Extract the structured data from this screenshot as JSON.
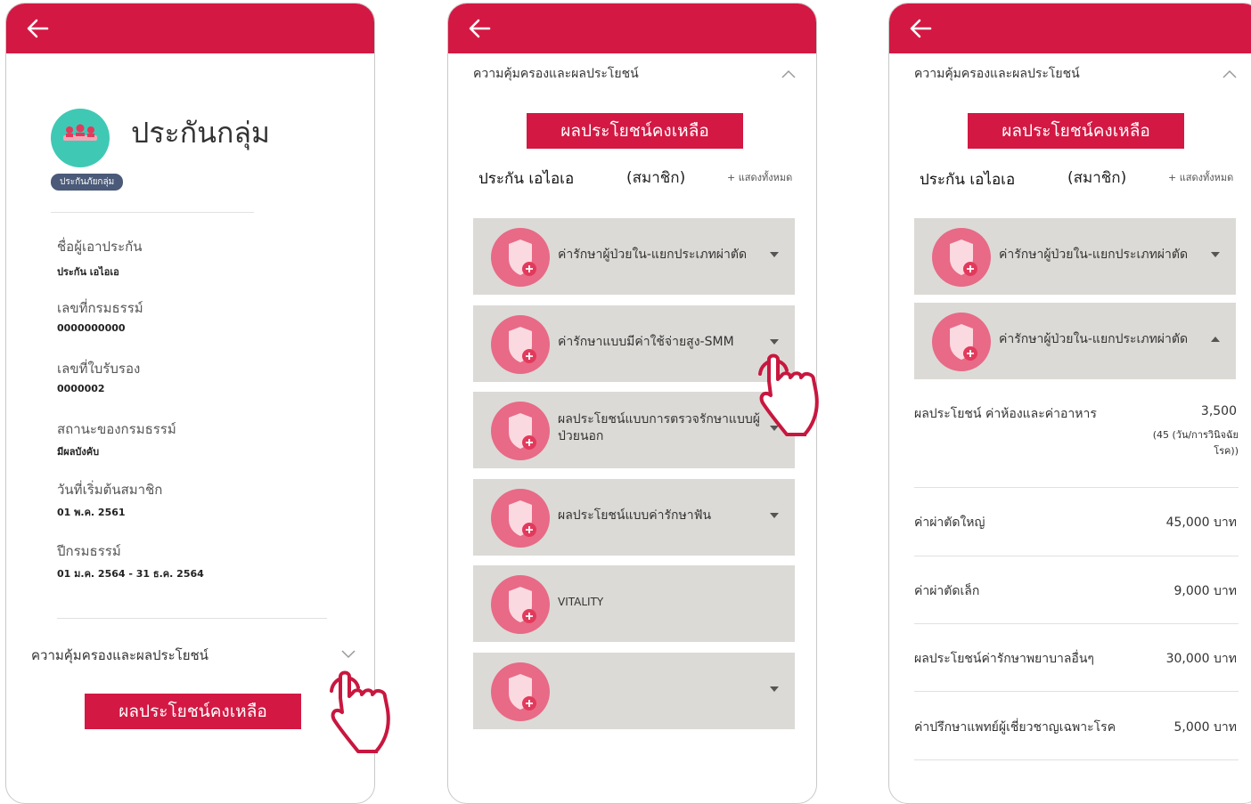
{
  "screen1": {
    "product_title": "ประกันกลุ่ม",
    "product_badge": "ประกันภัยกลุ่ม",
    "fields": [
      {
        "label": "ชื่อผู้เอาประกัน",
        "value": "ประกัน เอไอเอ"
      },
      {
        "label": "เลขที่กรมธรรม์",
        "value": "0000000000"
      },
      {
        "label": "เลขที่ใบรับรอง",
        "value": "0000002"
      },
      {
        "label": "สถานะของกรมธรรม์",
        "value": "มีผลบังคับ"
      },
      {
        "label": "วันที่เริ่มต้นสมาชิก",
        "value": "01 พ.ค. 2561"
      },
      {
        "label": "ปีกรมธรรม์",
        "value": "01 ม.ค. 2564 - 31 ธ.ค. 2564"
      }
    ],
    "section_title": "ความคุ้มครองและผลประโยชน์",
    "benefit_button": "ผลประโยชน์คงเหลือ"
  },
  "screen2": {
    "section_title": "ความคุ้มครองและผลประโยชน์",
    "benefit_button": "ผลประโยชน์คงเหลือ",
    "member_name": "ประกัน เอไอเอ",
    "member_role": "(สมาชิก)",
    "show_all": "+ แสดงทั้งหมด",
    "cards": [
      {
        "title": "ค่ารักษาผู้ป่วยใน-แยกประเภทผ่าตัด"
      },
      {
        "title": "ค่ารักษาแบบมีค่าใช้จ่ายสูง-SMM"
      },
      {
        "title": "ผลประโยชน์แบบการตรวจรักษาแบบผู้ป่วยนอก"
      },
      {
        "title": "ผลประโยชน์แบบค่ารักษาฟัน"
      },
      {
        "title": "VITALITY"
      },
      {
        "title": ""
      }
    ]
  },
  "screen3": {
    "section_title": "ความคุ้มครองและผลประโยชน์",
    "benefit_button": "ผลประโยชน์คงเหลือ",
    "member_name": "ประกัน เอไอเอ",
    "member_role": "(สมาชิก)",
    "show_all": "+ แสดงทั้งหมด",
    "cards": [
      {
        "title": "ค่ารักษาผู้ป่วยใน-แยกประเภทผ่าตัด"
      },
      {
        "title": "ค่ารักษาผู้ป่วยใน-แยกประเภทผ่าตัด"
      }
    ],
    "rows": [
      {
        "label": "ผลประโยชน์ ค่าห้องและค่าอาหาร",
        "value": "3,500",
        "note": "(45 (วัน/การวินิจฉัยโรค))"
      },
      {
        "label": "ค่าผ่าตัดใหญ่",
        "value": "45,000 บาท"
      },
      {
        "label": "ค่าผ่าตัดเล็ก",
        "value": "9,000 บาท"
      },
      {
        "label": "ผลประโยชน์ค่ารักษาพยาบาลอื่นๆ",
        "value": "30,000 บาท"
      },
      {
        "label": "ค่าปรึกษาแพทย์ผู้เชี่ยวชาญเฉพาะโรค",
        "value": "5,000 บาท"
      }
    ]
  },
  "colors": {
    "brand_red": "#d31843",
    "card_grey": "#dcdad6",
    "shield_pink": "#e86a86",
    "group_teal": "#3fc9b5"
  },
  "icons": [
    "back-arrow-icon",
    "group-people-icon",
    "shield-plus-icon",
    "chevron-down-icon",
    "chevron-up-icon",
    "tap-hand-icon"
  ]
}
